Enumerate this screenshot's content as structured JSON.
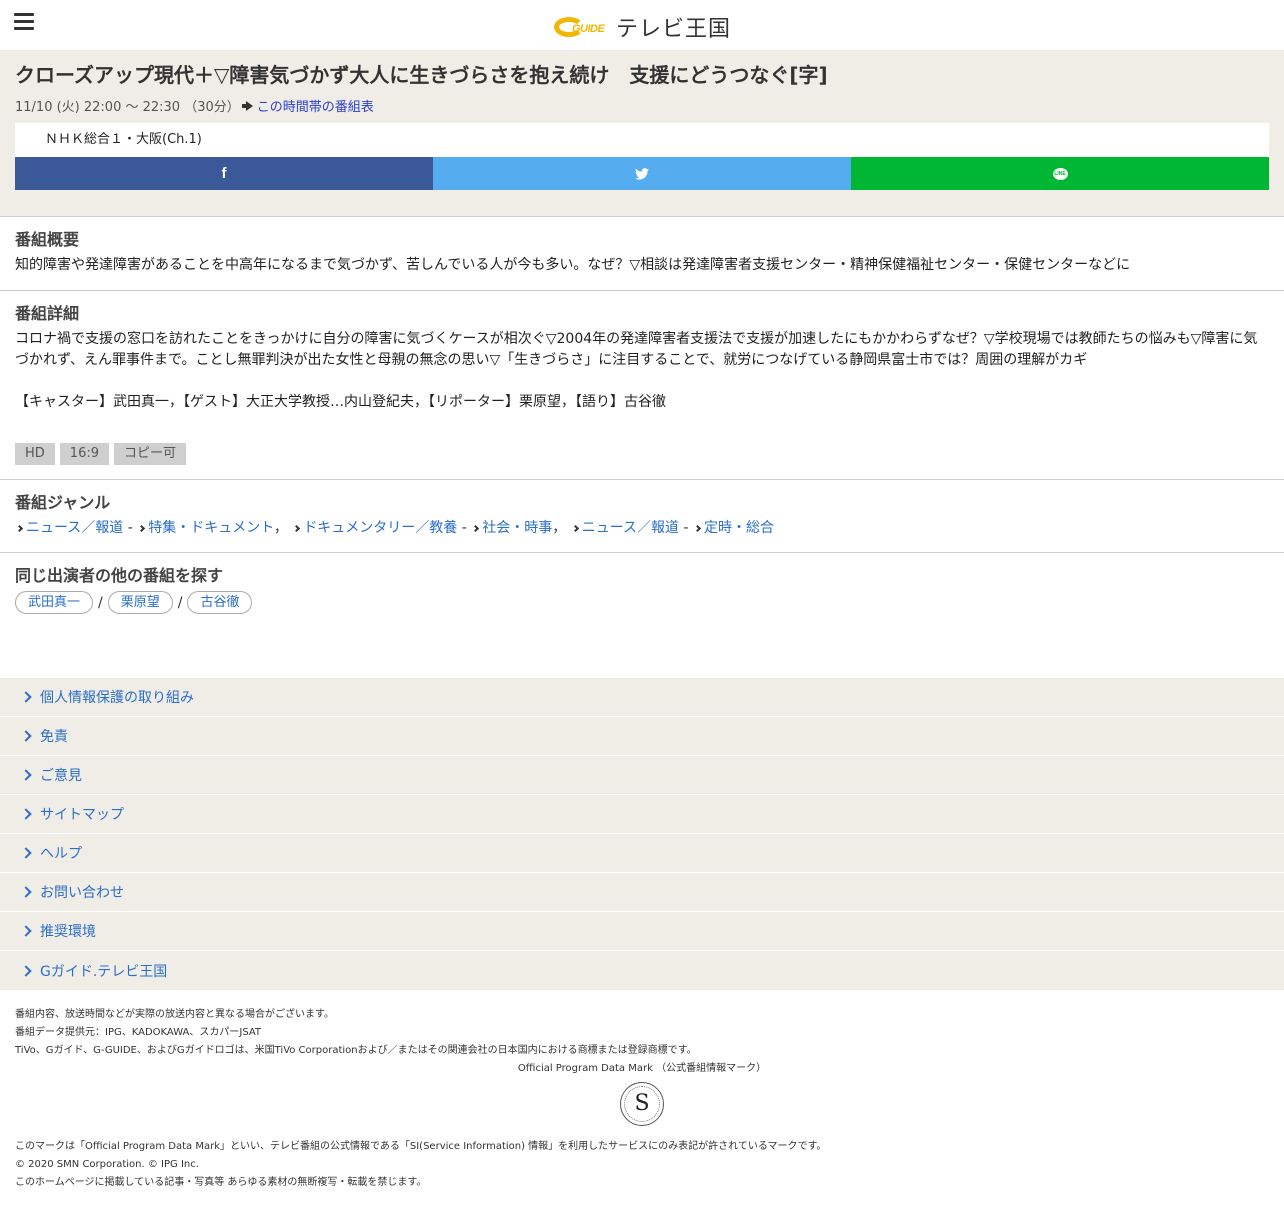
{
  "header": {
    "logo_mark": "GUIDE",
    "logo_text": "テレビ王国"
  },
  "program": {
    "title": "クローズアップ現代＋▽障害気づかず大人に生きづらさを抱え続け　支援にどうつなぐ[字]",
    "datetime": "11/10 (火) 22:00 ～ 22:30 （30分）",
    "timetable_link": "この時間帯の番組表",
    "channel": "ＮＨＫ総合１・大阪(Ch.1)"
  },
  "share": {
    "facebook_glyph": "f",
    "twitter_glyph": "🐦",
    "line_glyph": "LINE"
  },
  "overview": {
    "heading": "番組概要",
    "text": "知的障害や発達障害があることを中高年になるまで気づかず、苦しんでいる人が今も多い。なぜ？▽相談は発達障害者支援センター・精神保健福祉センター・保健センターなどに"
  },
  "detail": {
    "heading": "番組詳細",
    "text": "コロナ禍で支援の窓口を訪れたことをきっかけに自分の障害に気づくケースが相次ぐ▽2004年の発達障害者支援法で支援が加速したにもかかわらずなぜ？▽学校現場では教師たちの悩みも▽障害に気づかれず、えん罪事件まで。ことし無罪判決が出た女性と母親の無念の思い▽「生きづらさ」に注目することで、就労につなげている静岡県富士市では？周囲の理解がカギ\n\n【キャスター】武田真一，【ゲスト】大正大学教授…内山登紀夫，【リポーター】栗原望，【語り】古谷徹",
    "badges": [
      "HD",
      "16:9",
      "コピー可"
    ]
  },
  "genre": {
    "heading": "番組ジャンル",
    "groups": [
      {
        "main": "ニュース／報道",
        "sub": "特集・ドキュメント"
      },
      {
        "main": "ドキュメンタリー／教養",
        "sub": "社会・時事"
      },
      {
        "main": "ニュース／報道",
        "sub": "定時・総合"
      }
    ]
  },
  "cast": {
    "heading": "同じ出演者の他の番組を探す",
    "names": [
      "武田真一",
      "栗原望",
      "古谷徹"
    ]
  },
  "footer_nav": [
    "個人情報保護の取り組み",
    "免責",
    "ご意見",
    "サイトマップ",
    "ヘルプ",
    "お問い合わせ",
    "推奨環境",
    "Gガイド.テレビ王国"
  ],
  "legal": {
    "line1": "番組内容、放送時間などが実際の放送内容と異なる場合がございます。",
    "line2": "番組データ提供元：IPG、KADOKAWA、スカパーJSAT",
    "line3": "TiVo、Gガイド、G-GUIDE、およびGガイドロゴは、米国TiVo Corporationおよび／またはその関連会社の日本国内における商標または登録商標です。",
    "mark_title": "Official Program Data Mark （公式番組情報マーク）",
    "seal_letter": "S",
    "line4": "このマークは「Official Program Data Mark」といい、テレビ番組の公式情報である「SI(Service Information) 情報」を利用したサービスにのみ表記が許されているマークです。",
    "line5": "© 2020 SMN Corporation. © IPG Inc.",
    "line6": "このホームページに掲載している記事・写真等 あらゆる素材の無断複写・転載を禁じます。"
  },
  "colors": {
    "facebook": "#3b5998",
    "twitter": "#55acee",
    "line": "#00b733",
    "panel_bg": "#f0ede6",
    "link": "#2a6fc9"
  }
}
